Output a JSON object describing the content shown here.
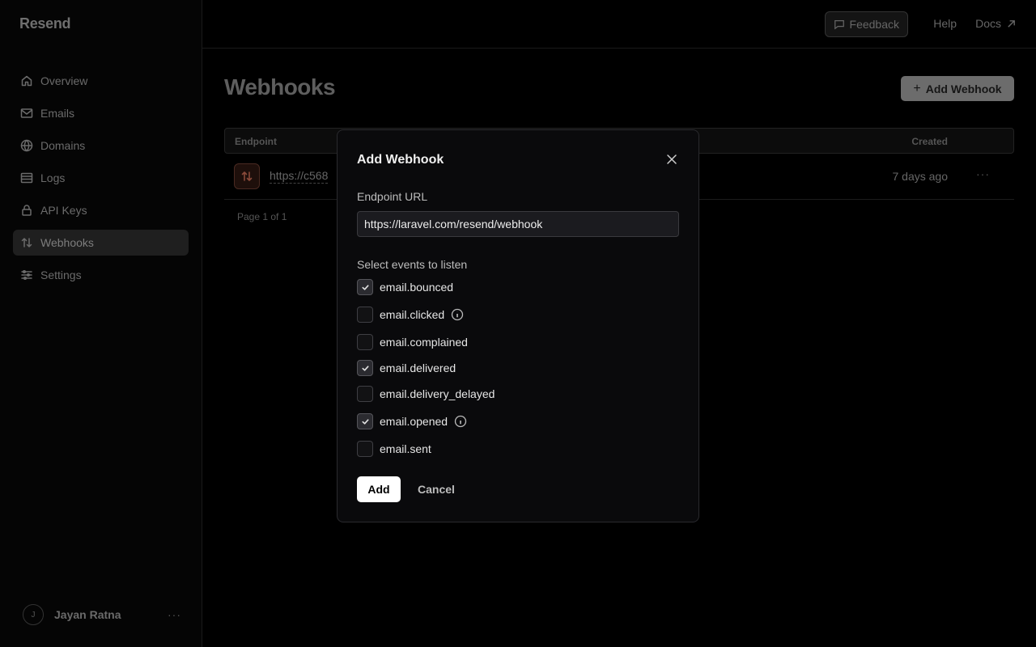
{
  "app": {
    "brand": "Resend"
  },
  "sidebar": {
    "items": [
      {
        "label": "Overview",
        "icon": "home-icon"
      },
      {
        "label": "Emails",
        "icon": "mail-icon"
      },
      {
        "label": "Domains",
        "icon": "globe-icon"
      },
      {
        "label": "Logs",
        "icon": "list-icon"
      },
      {
        "label": "API Keys",
        "icon": "lock-icon"
      },
      {
        "label": "Webhooks",
        "icon": "arrows-icon",
        "active": true
      },
      {
        "label": "Settings",
        "icon": "sliders-icon"
      }
    ],
    "user": {
      "initial": "J",
      "name": "Jayan Ratna",
      "more": "···"
    }
  },
  "topbar": {
    "feedback": "Feedback",
    "help": "Help",
    "docs": "Docs"
  },
  "main": {
    "title": "Webhooks",
    "add_button": "Add Webhook",
    "table": {
      "columns": {
        "endpoint": "Endpoint",
        "created": "Created"
      },
      "rows": [
        {
          "endpoint": "https://c568",
          "created": "7 days ago",
          "more": "···"
        }
      ]
    },
    "pagination": "Page 1 of 1"
  },
  "modal": {
    "title": "Add Webhook",
    "endpoint_label": "Endpoint URL",
    "endpoint_value": "https://laravel.com/resend/webhook",
    "events_label": "Select events to listen",
    "events": [
      {
        "name": "email.bounced",
        "checked": true,
        "info": false
      },
      {
        "name": "email.clicked",
        "checked": false,
        "info": true
      },
      {
        "name": "email.complained",
        "checked": false,
        "info": false
      },
      {
        "name": "email.delivered",
        "checked": true,
        "info": false
      },
      {
        "name": "email.delivery_delayed",
        "checked": false,
        "info": false
      },
      {
        "name": "email.opened",
        "checked": true,
        "info": true
      },
      {
        "name": "email.sent",
        "checked": false,
        "info": false
      }
    ],
    "add_button": "Add",
    "cancel_button": "Cancel"
  }
}
